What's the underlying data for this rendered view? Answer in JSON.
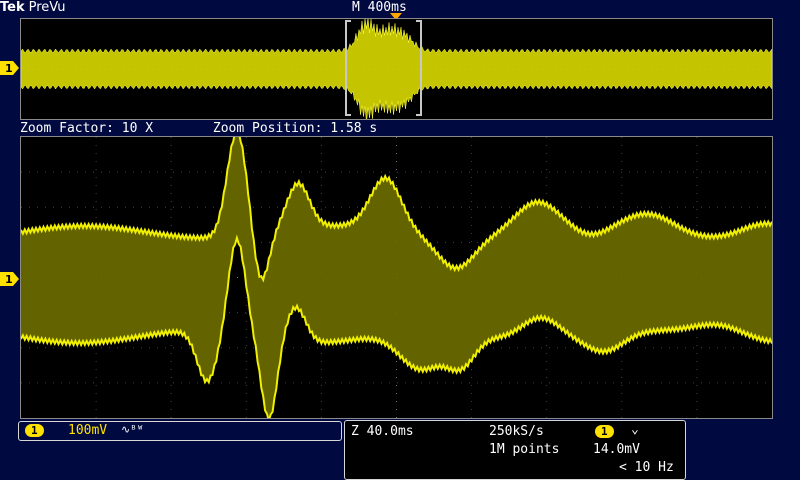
{
  "brand": {
    "logo": "Tek",
    "mode": "PreVu"
  },
  "timebase": {
    "label": "M 400ms"
  },
  "zoom": {
    "factor_label": "Zoom Factor: 10 X",
    "position_label": "Zoom Position: 1.58 s"
  },
  "channel": {
    "number": "1",
    "marker": "1",
    "scale": "100mV",
    "bw_limit_symbol": "∿ᴮᵂ"
  },
  "acquisition": {
    "zoom_scale": "Z 40.0ms",
    "sample_rate": "250kS/s",
    "record_length": "1M points",
    "trigger_source": "1",
    "trigger_slope_symbol": "⌄",
    "trigger_level": "14.0mV",
    "trigger_freq": "< 10 Hz"
  },
  "colors": {
    "trace": "#f0f000",
    "marker": "#ffa500",
    "background": "#000a40"
  }
}
